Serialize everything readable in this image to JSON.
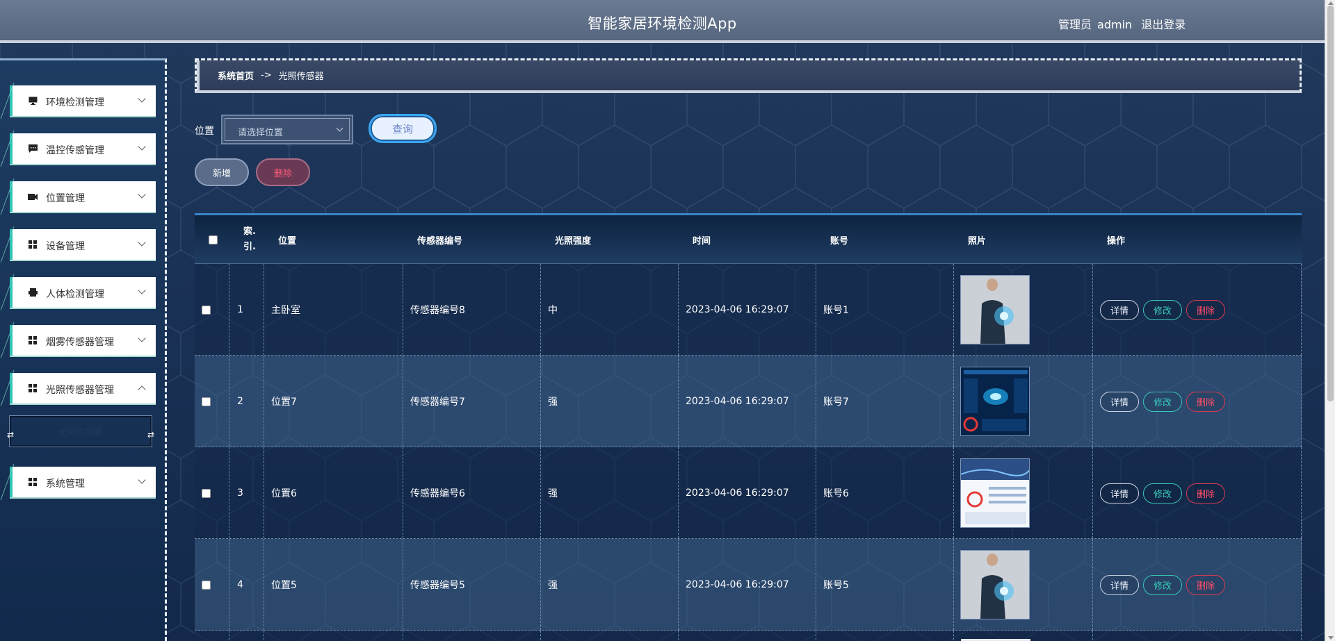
{
  "header": {
    "app_title": "智能家居环境检测App",
    "role": "管理员",
    "username": "admin",
    "logout": "退出登录"
  },
  "sidebar": {
    "items": [
      {
        "label": "环境检测管理",
        "icon": "monitor-icon"
      },
      {
        "label": "温控传感管理",
        "icon": "chat-icon"
      },
      {
        "label": "位置管理",
        "icon": "video-icon"
      },
      {
        "label": "设备管理",
        "icon": "grid-icon"
      },
      {
        "label": "人体检测管理",
        "icon": "printer-icon"
      },
      {
        "label": "烟雾传感器管理",
        "icon": "grid-icon"
      },
      {
        "label": "光照传感器管理",
        "icon": "grid-icon"
      },
      {
        "label": "系统管理",
        "icon": "grid-icon"
      }
    ],
    "submenu_active": "光照传感器"
  },
  "breadcrumb": {
    "home": "系统首页",
    "sep": "->",
    "current": "光照传感器"
  },
  "search": {
    "label": "位置",
    "placeholder": "请选择位置",
    "query_button": "查询"
  },
  "actions": {
    "add": "新增",
    "delete": "删除"
  },
  "table": {
    "columns": {
      "index_a": "索.",
      "index_b": "引.",
      "location": "位置",
      "sensor_no": "传感器编号",
      "light": "光照强度",
      "time": "时间",
      "account": "账号",
      "photo": "照片",
      "ops": "操作"
    },
    "rows": [
      {
        "index": "1",
        "location": "主卧室",
        "sensor_no": "传感器编号8",
        "light": "中",
        "time": "2023-04-06 16:29:07",
        "account": "账号1",
        "photo": "person"
      },
      {
        "index": "2",
        "location": "位置7",
        "sensor_no": "传感器编号7",
        "light": "强",
        "time": "2023-04-06 16:29:07",
        "account": "账号7",
        "photo": "dashboard-dark"
      },
      {
        "index": "3",
        "location": "位置6",
        "sensor_no": "传感器编号6",
        "light": "强",
        "time": "2023-04-06 16:29:07",
        "account": "账号6",
        "photo": "dashboard-light"
      },
      {
        "index": "4",
        "location": "位置5",
        "sensor_no": "传感器编号5",
        "light": "强",
        "time": "2023-04-06 16:29:07",
        "account": "账号5",
        "photo": "person"
      }
    ],
    "row_actions": {
      "detail": "详情",
      "edit": "修改",
      "delete": "删除"
    }
  },
  "colors": {
    "accent": "#3aa4f2",
    "edit": "#37c8b8",
    "danger": "#ff4d6a"
  }
}
